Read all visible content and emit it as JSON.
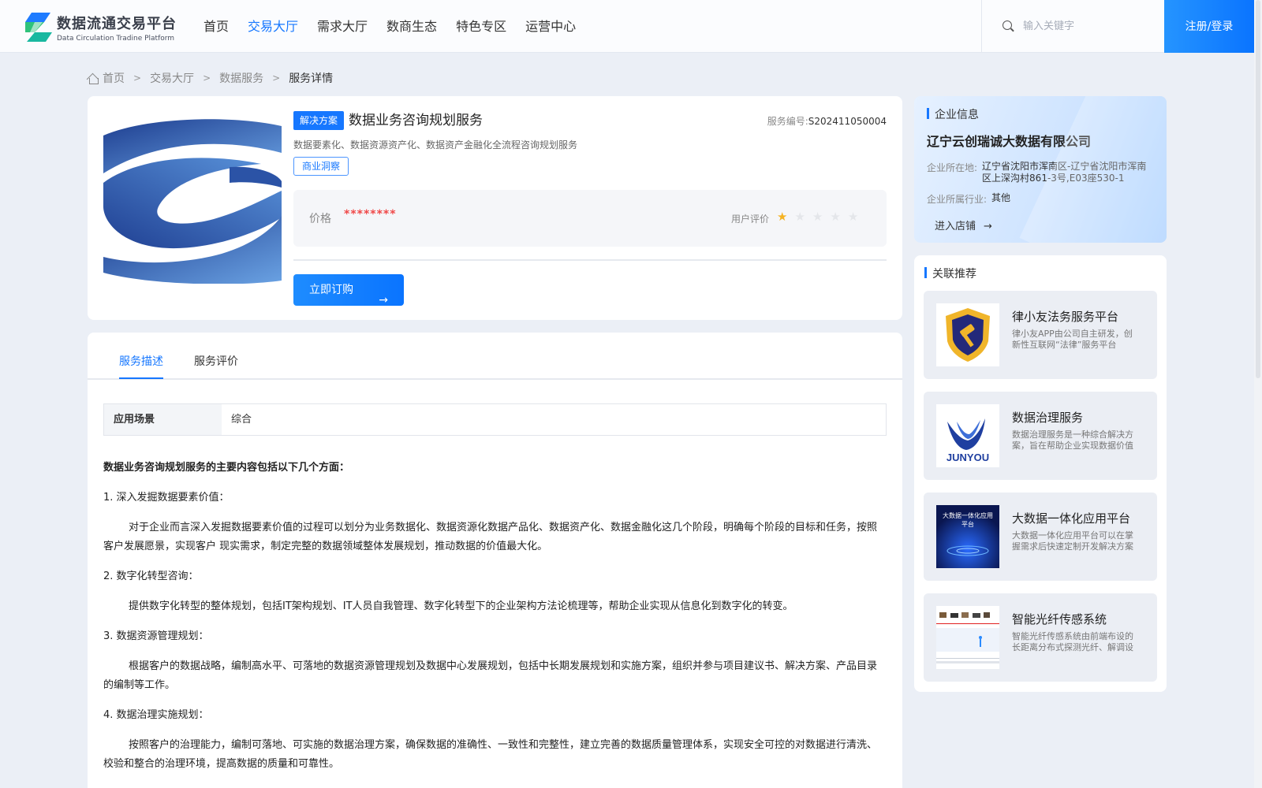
{
  "header": {
    "logo_cn": "数据流通交易平台",
    "logo_en": "Data Circulation Tradine Platform",
    "nav": [
      "首页",
      "交易大厅",
      "需求大厅",
      "数商生态",
      "特色专区",
      "运营中心"
    ],
    "active_nav": 1,
    "search_placeholder": "输入关键字",
    "login_label": "注册/登录"
  },
  "breadcrumb": {
    "home": "首页",
    "items": [
      "交易大厅",
      "数据服务",
      "服务详情"
    ],
    "separator": ">"
  },
  "product": {
    "tag": "解决方案",
    "title": "数据业务咨询规划服务",
    "service_no_label": "服务编号:",
    "service_no": "S202411050004",
    "subtitle": "数据要素化、数据资源资产化、数据资产金融化全流程咨询规划服务",
    "category_tag": "商业洞察",
    "price_label": "价格",
    "price_value": "********",
    "rating_label": "用户评价",
    "rating": 1,
    "rating_max": 5,
    "subscribe_label": "立即订购",
    "arrow": "→"
  },
  "enterprise": {
    "section_title": "企业信息",
    "name": "辽宁云创瑞诚大数据有限公司",
    "location_label": "企业所在地:",
    "location": "辽宁省沈阳市浑南区-辽宁省沈阳市浑南区上深沟村861-3号,E03座530-1",
    "industry_label": "企业所属行业:",
    "industry": "其他",
    "enter_shop": "进入店铺",
    "arrow": "→"
  },
  "recommend": {
    "section_title": "关联推荐",
    "items": [
      {
        "title": "律小友法务服务平台",
        "desc": "律小友APP由公司自主研发，创新性互联网“法律”服务平台"
      },
      {
        "title": "数据治理服务",
        "desc": "数据治理服务是一种综合解决方案，旨在帮助企业实现数据价值"
      },
      {
        "title": "大数据一体化应用平台",
        "desc": "大数据一体化应用平台可以在掌握需求后快速定制开发解决方案"
      },
      {
        "title": "智能光纤传感系统",
        "desc": "智能光纤传感系统由前端布设的长距离分布式探测光纤、解调设备组成"
      }
    ],
    "thumb3_text": "大数据一体化应用平台",
    "thumb2_text": "JUNYOU"
  },
  "tabs": [
    "服务描述",
    "服务评价"
  ],
  "active_tab": 0,
  "scene": {
    "label": "应用场景",
    "value": "综合"
  },
  "description": {
    "heading": "数据业务咨询规划服务的主要内容包括以下几个方面：",
    "sections": [
      {
        "title": "1. 深入发掘数据要素价值：",
        "body": "对于企业而言深入发掘数据要素价值的过程可以划分为业务数据化、数据资源化数据产品化、数据资产化、数据金融化这几个阶段，明确每个阶段的目标和任务，按照客户发展愿景，实现客户 现实需求，制定完整的数据领域整体发展规划，推动数据的价值最大化。"
      },
      {
        "title": "2. 数字化转型咨询：",
        "body": "提供数字化转型的整体规划，包括IT架构规划、IT人员自我管理、数字化转型下的企业架构方法论梳理等，帮助企业实现从信息化到数字化的转变。"
      },
      {
        "title": "3. 数据资源管理规划：",
        "body": "根据客户的数据战略，编制高水平、可落地的数据资源管理规划及数据中心发展规划，包括中长期发展规划和实施方案，组织并参与项目建议书、解决方案、产品目录的编制等工作。"
      },
      {
        "title": "4. 数据治理实施规划：",
        "body": "按照客户的治理能力，编制可落地、可实施的数据治理方案，确保数据的准确性、一致性和完整性，建立完善的数据质量管理体系，实现安全可控的对数据进行清洗、校验和整合的治理环境，提高数据的质量和可靠性。"
      }
    ]
  },
  "colors": {
    "brand": "#1677ff",
    "price": "#f04848",
    "star": "#f5b323",
    "logo_green": "#2fc27a"
  }
}
